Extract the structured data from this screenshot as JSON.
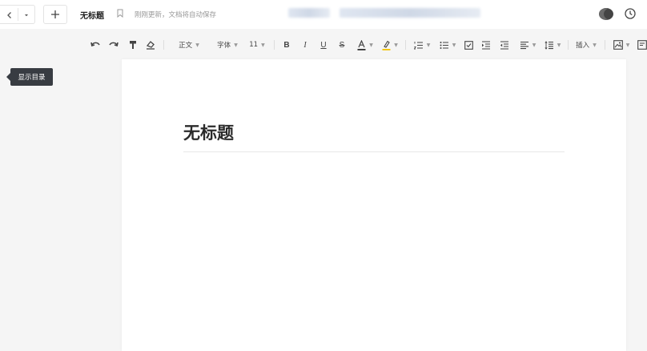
{
  "header": {
    "doc_title": "无标题",
    "save_status": "刚刚更新，文档将自动保存"
  },
  "toolbar": {
    "paragraph_style": "正文",
    "font_family": "字体",
    "font_size": "11",
    "insert_label": "插入"
  },
  "sidebar": {
    "outline_tip": "显示目录"
  },
  "document": {
    "heading": "无标题"
  },
  "colors": {
    "font_color_bar": "#333333",
    "highlight_bar": "#f2c200"
  },
  "icons": [
    "back-icon",
    "dropdown-icon",
    "plus-icon",
    "bookmark-icon",
    "theme-toggle-icon",
    "history-icon",
    "undo-icon",
    "redo-icon",
    "format-painter-icon",
    "clear-format-icon",
    "bold-icon",
    "italic-icon",
    "underline-icon",
    "strikethrough-icon",
    "font-color-icon",
    "highlight-icon",
    "ordered-list-icon",
    "bullet-list-icon",
    "checklist-icon",
    "indent-increase-icon",
    "indent-decrease-icon",
    "align-icon",
    "line-spacing-icon",
    "image-icon",
    "more-icon"
  ]
}
